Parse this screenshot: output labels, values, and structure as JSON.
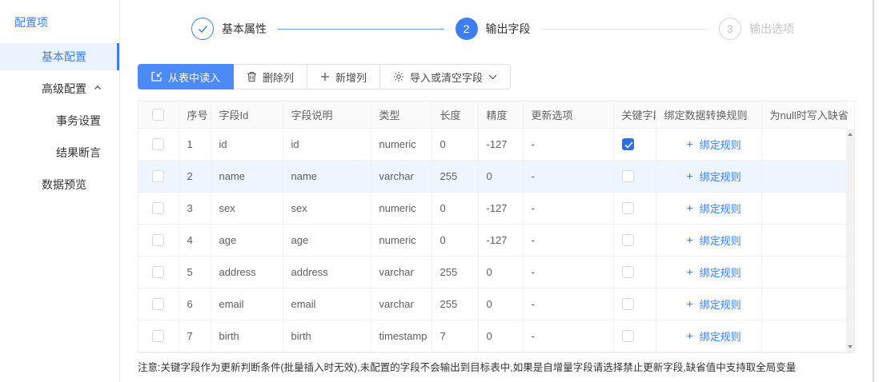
{
  "colors": {
    "accent": "#3d7ef2",
    "primary_button": "#4c8bf5",
    "checkbox_checked": "#2f6fe6",
    "row_highlight": "#edf5fe",
    "sidebar_active_bg": "#eaf3fe"
  },
  "sidebar": {
    "title": "配置项",
    "items": [
      {
        "label": "基本配置"
      },
      {
        "label": "高级配置"
      },
      {
        "label": "事务设置"
      },
      {
        "label": "结果断言"
      },
      {
        "label": "数据预览"
      }
    ]
  },
  "stepper": {
    "steps": [
      {
        "number": "",
        "label": "基本属性",
        "state": "done"
      },
      {
        "number": "2",
        "label": "输出字段",
        "state": "active"
      },
      {
        "number": "3",
        "label": "输出选项",
        "state": "pending"
      }
    ]
  },
  "toolbar": {
    "read_from_table": "从表中读入",
    "delete_column": "删除列",
    "add_column": "新增列",
    "import_or_clear": "导入或清空字段"
  },
  "table": {
    "columns": [
      "序号",
      "字段Id",
      "字段说明",
      "类型",
      "长度",
      "精度",
      "更新选项",
      "关键字段",
      "绑定数据转换规则",
      "为null时写入缺省值"
    ],
    "bind_rule_label": "绑定规则",
    "rows": [
      {
        "no": "1",
        "field_id": "id",
        "field_desc": "id",
        "type": "numeric",
        "length": "0",
        "precision": "-127",
        "update_option": "-",
        "key_field": true,
        "highlight": false,
        "default_value": ""
      },
      {
        "no": "2",
        "field_id": "name",
        "field_desc": "name",
        "type": "varchar",
        "length": "255",
        "precision": "0",
        "update_option": "-",
        "key_field": false,
        "highlight": true,
        "default_value": ""
      },
      {
        "no": "3",
        "field_id": "sex",
        "field_desc": "sex",
        "type": "numeric",
        "length": "0",
        "precision": "-127",
        "update_option": "-",
        "key_field": false,
        "highlight": false,
        "default_value": ""
      },
      {
        "no": "4",
        "field_id": "age",
        "field_desc": "age",
        "type": "numeric",
        "length": "0",
        "precision": "-127",
        "update_option": "-",
        "key_field": false,
        "highlight": false,
        "default_value": ""
      },
      {
        "no": "5",
        "field_id": "address",
        "field_desc": "address",
        "type": "varchar",
        "length": "255",
        "precision": "0",
        "update_option": "-",
        "key_field": false,
        "highlight": false,
        "default_value": ""
      },
      {
        "no": "6",
        "field_id": "email",
        "field_desc": "email",
        "type": "varchar",
        "length": "255",
        "precision": "0",
        "update_option": "-",
        "key_field": false,
        "highlight": false,
        "default_value": ""
      },
      {
        "no": "7",
        "field_id": "birth",
        "field_desc": "birth",
        "type": "timestamp",
        "length": "7",
        "precision": "0",
        "update_option": "-",
        "key_field": false,
        "highlight": false,
        "default_value": ""
      }
    ]
  },
  "note": "注意:关键字段作为更新判断条件(批量插入时无效),未配置的字段不会输出到目标表中,如果是自增量字段请选择禁止更新字段,缺省值中支持取全局变量"
}
